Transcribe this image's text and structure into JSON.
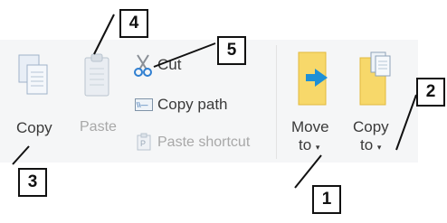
{
  "clipboard": {
    "copy_label": "Copy",
    "paste_label": "Paste",
    "cut_label": "Cut",
    "copy_path_label": "Copy path",
    "paste_shortcut_label": "Paste shortcut"
  },
  "organize": {
    "move_to_line1": "Move",
    "move_to_line2": "to",
    "copy_to_line1": "Copy",
    "copy_to_line2": "to",
    "dropdown_glyph": "▾"
  },
  "callouts": [
    "1",
    "2",
    "3",
    "4",
    "5"
  ],
  "icons": {
    "copy": "copy-icon",
    "paste": "paste-icon",
    "cut": "scissors-icon",
    "copy_path": "copy-path-icon",
    "paste_shortcut": "paste-shortcut-icon",
    "move_to": "move-to-folder-icon",
    "copy_to": "copy-to-folder-icon"
  },
  "colors": {
    "ribbon_bg": "#f5f6f7",
    "folder": "#f7d86a",
    "arrow": "#1e90d6",
    "disabled_text": "#a8a8a8"
  }
}
